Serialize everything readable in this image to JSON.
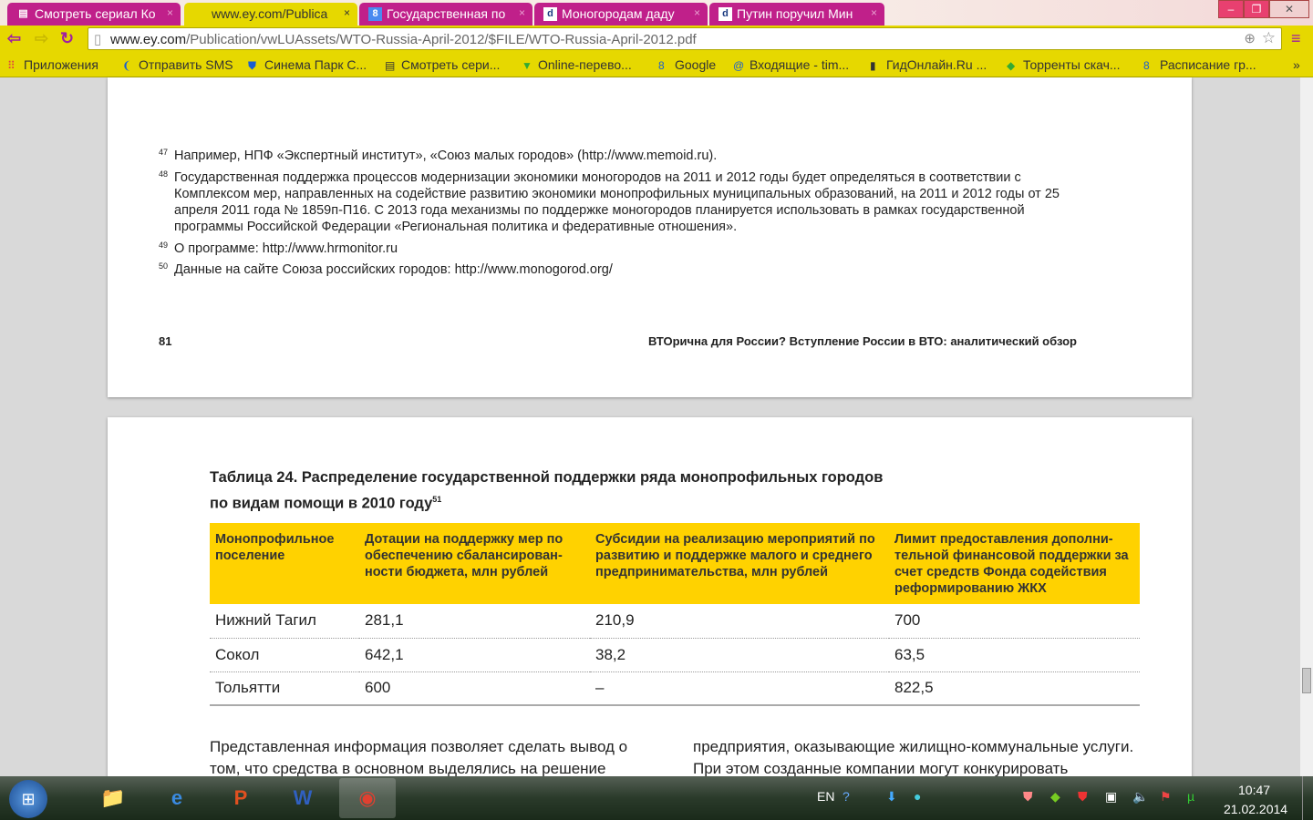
{
  "tabs": [
    {
      "label": "Смотреть сериал Ко",
      "icon": "film-icon"
    },
    {
      "label": "www.ey.com/Publica",
      "icon": "none",
      "active": true
    },
    {
      "label": "Государственная по",
      "icon": "google-icon"
    },
    {
      "label": "Моногородам даду",
      "icon": "d-icon"
    },
    {
      "label": "Путин поручил Мин",
      "icon": "d-icon"
    }
  ],
  "url_host": "www.ey.com",
  "url_path": "/Publication/vwLUAssets/WTO-Russia-April-2012/$FILE/WTO-Russia-April-2012.pdf",
  "bookmarks": [
    "Приложения",
    "Отправить SMS",
    "Синема Парк С...",
    "Смотреть сери...",
    "Online-перево...",
    "Google",
    "Входящие - tim...",
    "ГидОнлайн.Ru ...",
    "Торренты скач...",
    "Расписание гр..."
  ],
  "footnotes": [
    {
      "n": "47",
      "text": "Например, НПФ «Экспертный институт», «Союз малых городов» (http://www.memoid.ru)."
    },
    {
      "n": "48",
      "text": "Государственная поддержка процессов модернизации экономики моногородов на 2011 и 2012 годы будет определяться в соответствии с Комплексом мер, направленных на содействие развитию экономики монопрофильных муниципальных образований, на 2011 и 2012 годы от 25 апреля 2011 года № 1859п-П16. С 2013 года механизмы по поддержке моногородов планируется использовать в рамках государственной программы Российской Федерации «Региональная политика и федеративные отношения»."
    },
    {
      "n": "49",
      "text": "О программе: http://www.hrmonitor.ru"
    },
    {
      "n": "50",
      "text": "Данные на сайте Союза российских городов: http://www.monogorod.org/"
    }
  ],
  "page_number": "81",
  "running_title": "ВТОрична для России? Вступление России в ВТО: аналитический обзор",
  "table": {
    "title_line1": "Таблица 24. Распределение государственной поддержки ряда монопрофильных городов",
    "title_line2": "по видам помощи в 2010 году",
    "title_sup": "51",
    "headers": [
      "Монопрофильное поселение",
      "Дотации на поддержку мер по обеспечению сбалансирован-ности бюджета, млн рублей",
      "Субсидии на реализацию мероприятий по развитию и поддержке малого и среднего предпринимательства, млн рублей",
      "Лимит предоставления дополни-тельной финансовой поддержки за счет средств Фонда содействия реформированию ЖКХ"
    ],
    "rows": [
      [
        "Нижний Тагил",
        "281,1",
        "210,9",
        "700"
      ],
      [
        "Сокол",
        "642,1",
        "38,2",
        "63,5"
      ],
      [
        "Тольятти",
        "600",
        "–",
        "822,5"
      ]
    ]
  },
  "body_left": "Представленная информация позволяет сделать вывод о том, что средства в основном выделялись на решение",
  "body_right": "предприятия, оказывающие жилищно-коммунальные услуги. При этом созданные компании могут конкурировать",
  "tray": {
    "lang": "EN",
    "time": "10:47",
    "date": "21.02.2014"
  }
}
